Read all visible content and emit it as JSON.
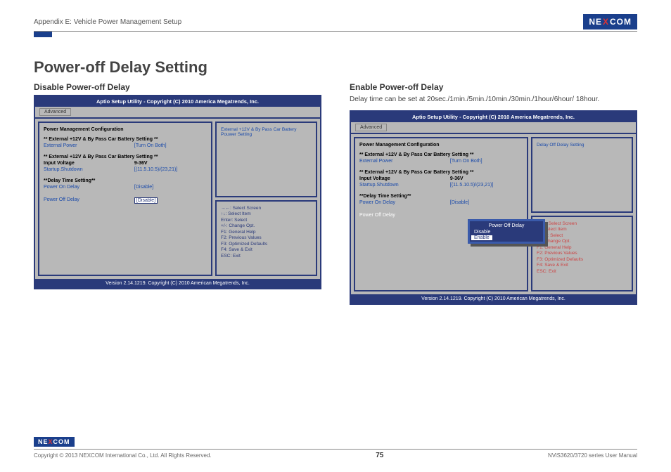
{
  "header": {
    "appendix": "Appendix E: Vehicle Power Management Setup",
    "logo_pre": "NE",
    "logo_x": "X",
    "logo_post": "COM"
  },
  "title": "Power-off Delay Setting",
  "left": {
    "heading": "Disable Power-off Delay",
    "bios": {
      "title": "Aptio Setup Utility - Copyright (C) 2010 America Megatrends, Inc.",
      "tab": "Advanced",
      "section_title": "Power Management Configuration",
      "grp1": "** External +12V & By Pass Car Battery Setting **",
      "row1_l": "External Power",
      "row1_v": "[Turn On Both]",
      "grp2": "** External +12V & By Pass Car Battery Setting **",
      "row2_l": "Input Voltage",
      "row2_v": "9-36V",
      "row3_l": "Startup.Shutdown",
      "row3_v": "[(11.5.10.5)/(23,21)]",
      "grp3": "**Delay Time Setting**",
      "row4_l": "Power On Delay",
      "row4_v": "[Disable]",
      "row5_l": "Power Off Delay",
      "row5_v": "[Disable]",
      "right_top": "External +12V & By Pass Car Battery Pouwer Setting",
      "help": [
        "→←: Select Screen",
        "↑↓: Select Item",
        "Enter: Select",
        "+/-: Change Opt.",
        "F1: General Help",
        "F2: Previous Values",
        "F3: Optimized Defaults",
        "F4: Save & Exit",
        "ESC: Exit"
      ],
      "footer": "Version 2.14.1219. Copyright (C) 2010 American Megatrends, Inc."
    }
  },
  "right": {
    "heading": "Enable Power-off Delay",
    "desc": "Delay time can be set at 20sec./1min./5min./10min./30min./1hour/6hour/ 18hour.",
    "bios": {
      "title": "Aptio Setup Utility - Copyright (C) 2010 America Megatrends, Inc.",
      "tab": "Advanced",
      "section_title": "Power Management Configuration",
      "grp1": "** External +12V & By Pass Car Battery Setting **",
      "row1_l": "External Power",
      "row1_v": "[Turn On Both]",
      "grp2": "** External +12V & By Pass Car Battery Setting **",
      "row2_l": "Input Voltage",
      "row2_v": "9-36V",
      "row3_l": "Startup.Shutdown",
      "row3_v": "[(11.5.10.5)/(23,21)]",
      "grp3": "**Delay Time Setting**",
      "row4_l": "Power On Delay",
      "row4_v": "[Disable]",
      "row5_l": "Power Off Delay",
      "row5_v": "",
      "popup_title": "Power Off Delay",
      "popup_opt1": "Disable",
      "popup_opt2": "Enable",
      "right_top": "Delay Off Delay Setting",
      "help": [
        "→←: Select Screen",
        "↑↓: Select Item",
        "Enter: Select",
        "+/-: Change Opt.",
        "F1: General Help",
        "F2: Previous Values",
        "F3: Optimized Defaults",
        "F4: Save & Exit",
        "ESC: Exit"
      ],
      "footer": "Version 2.14.1219. Copyright (C) 2010 American Megatrends, Inc."
    }
  },
  "footer": {
    "copy": "Copyright © 2013 NEXCOM International Co., Ltd. All Rights Reserved.",
    "page": "75",
    "manual": "NViS3620/3720 series User Manual"
  }
}
